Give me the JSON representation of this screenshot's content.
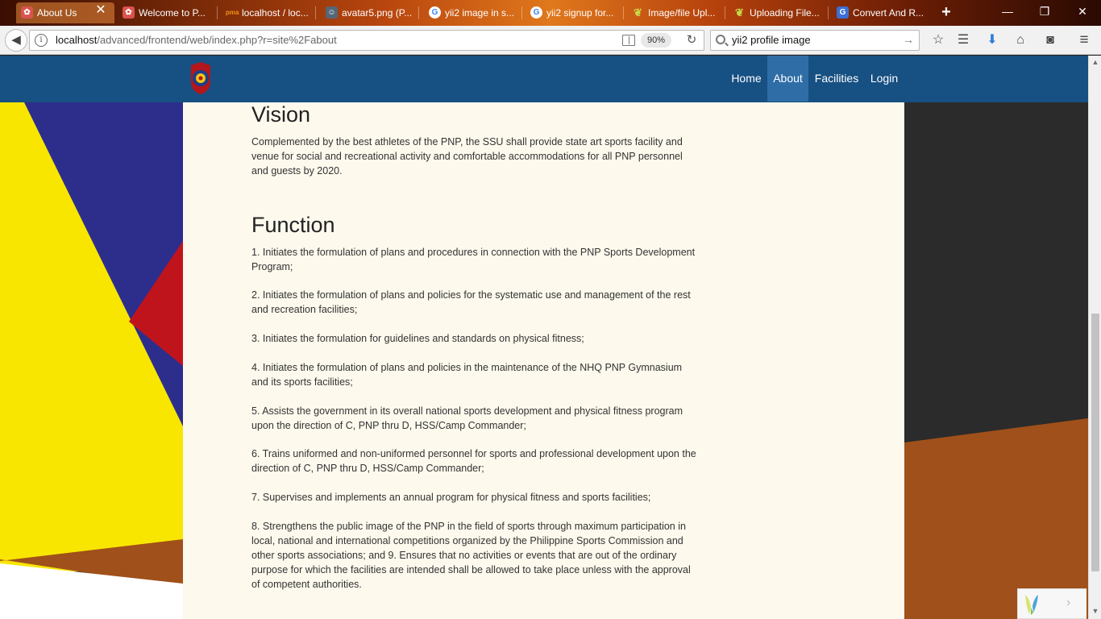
{
  "browser": {
    "tabs": [
      {
        "title": "About Us",
        "icon": "yii-favicon-icon",
        "icon_color": "#d9534f",
        "active": true
      },
      {
        "title": "Welcome to P...",
        "icon": "yii-favicon-icon",
        "icon_color": "#d9534f",
        "active": false
      },
      {
        "title": "localhost / loc...",
        "icon": "phpmyadmin-icon",
        "icon_color": "#f29111",
        "active": false
      },
      {
        "title": "avatar5.png (P...",
        "icon": "avatar-icon",
        "icon_color": "#556677",
        "active": false
      },
      {
        "title": "yii2 image in s...",
        "icon": "google-icon",
        "icon_color": "#ffffff",
        "active": false
      },
      {
        "title": "yii2 signup for...",
        "icon": "google-icon",
        "icon_color": "#ffffff",
        "active": false
      },
      {
        "title": "Image/file Upl...",
        "icon": "yii-framework-icon",
        "icon_color": "#c8d94b",
        "active": false
      },
      {
        "title": "Uploading File...",
        "icon": "yii-framework-icon",
        "icon_color": "#c8d94b",
        "active": false
      },
      {
        "title": "Convert And R...",
        "icon": "google-g-icon",
        "icon_color": "#3b6fd6",
        "active": false
      }
    ],
    "url_host": "localhost",
    "url_path": "/advanced/frontend/web/index.php?r=site%2Fabout",
    "zoom": "90%",
    "search_value": "yii2 profile image"
  },
  "site": {
    "nav": [
      {
        "label": "Home",
        "active": false
      },
      {
        "label": "About",
        "active": true
      },
      {
        "label": "Facilities",
        "active": false
      },
      {
        "label": "Login",
        "active": false
      }
    ],
    "vision": {
      "heading": "Vision",
      "text": "Complemented by the best athletes of the PNP, the SSU shall provide state art sports facility and venue for social and recreational activity and comfortable accommodations for all PNP personnel and guests by 2020."
    },
    "function": {
      "heading": "Function",
      "items": [
        "1. Initiates the formulation of plans and procedures in connection with the PNP Sports Development Program;",
        "2. Initiates the formulation of plans and policies for the systematic use and management of the rest and recreation facilities;",
        "3. Initiates the formulation for guidelines and standards on physical fitness;",
        "4. Initiates the formulation of plans and policies in the maintenance of the NHQ PNP Gymnasium and its sports facilities;",
        "5. Assists the government in its overall national sports development and physical fitness program upon the direction of C, PNP thru D, HSS/Camp Commander;",
        "6. Trains uniformed and non-uniformed personnel for sports and professional development upon the direction of C, PNP thru D, HSS/Camp Commander;",
        "7. Supervises and implements an annual program for physical fitness and sports facilities;",
        "8. Strengthens the public image of the PNP in the field of sports through maximum participation in local, national and international competitions organized by the Philippine Sports Commission and other sports associations; and 9. Ensures that no activities or events that are out of the ordinary purpose for which the facilities are intended shall be allowed to take place unless with the approval of competent authorities."
      ]
    }
  },
  "colors": {
    "site_nav": "#175082",
    "content_bg": "#fdf9ed",
    "bg_yellow": "#f8e600",
    "bg_blue": "#2d2e8c",
    "bg_red": "#c0141c",
    "bg_orange": "#a0501a"
  }
}
